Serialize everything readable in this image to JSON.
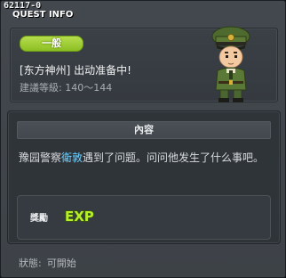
{
  "window": {
    "quest_id": "62117-0",
    "title": "QUEST INFO"
  },
  "quest": {
    "badge": "一般",
    "name": "[东方神州] 出动准备中!",
    "level_text": "建議等級: 140～144",
    "npc_icon": "soldier-npc-portrait"
  },
  "content": {
    "header": "內容",
    "text_before": "豫园警察",
    "text_highlight": "衛敦",
    "text_after": "遇到了问题。问问他发生了什么事吧。",
    "highlight_color": "#6fd0ff"
  },
  "reward": {
    "label": "獎勵",
    "exp_icon": "exp-icon",
    "exp_text": "EXP"
  },
  "status": {
    "label": "狀態:",
    "value": "可開始"
  },
  "colors": {
    "badge": "#9ccc2e",
    "exp": "#a8e62a"
  }
}
